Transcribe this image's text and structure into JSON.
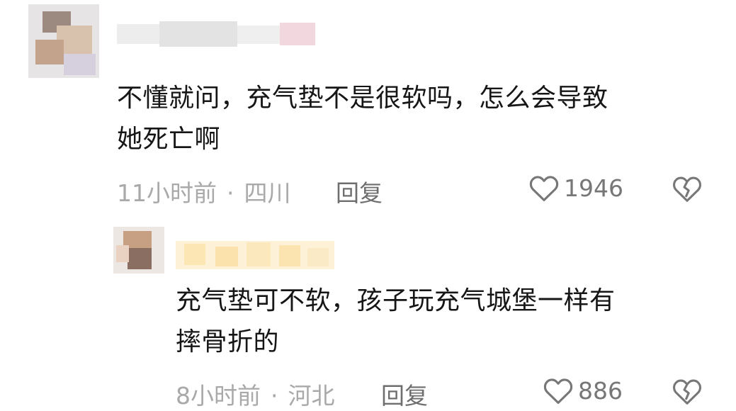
{
  "comments": [
    {
      "text_line1": "不懂就问，充气垫不是很软吗，怎么会导致",
      "text_line2": "她死亡啊",
      "time": "11小时前",
      "location": "四川",
      "reply_label": "回复",
      "likes": "1946"
    },
    {
      "text_line1": "充气垫可不软，孩子玩充气城堡一样有",
      "text_line2": "摔骨折的",
      "time": "8小时前",
      "location": "河北",
      "reply_label": "回复",
      "likes": "886"
    }
  ],
  "separator": "·",
  "icons": {
    "like": "heart-outline-icon",
    "dislike": "broken-heart-icon"
  },
  "colors": {
    "text": "#161616",
    "meta": "#a9a9a9",
    "icon": "#777777"
  }
}
